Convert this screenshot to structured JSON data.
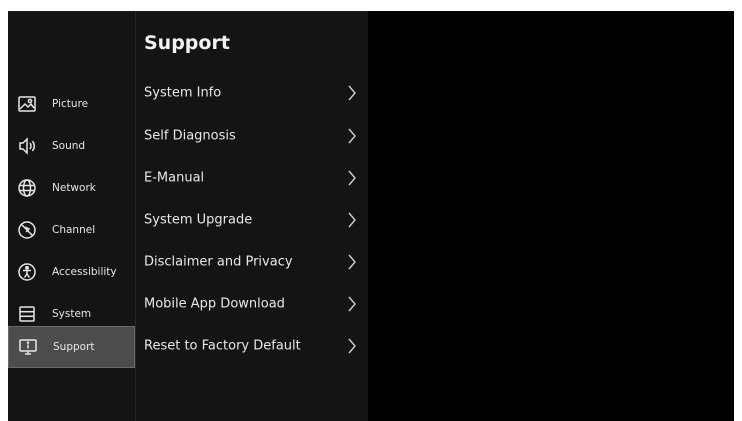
{
  "sidebar": {
    "items": [
      {
        "id": "picture",
        "label": "Picture",
        "icon": "picture-icon",
        "selected": false
      },
      {
        "id": "sound",
        "label": "Sound",
        "icon": "speaker-icon",
        "selected": false
      },
      {
        "id": "network",
        "label": "Network",
        "icon": "globe-icon",
        "selected": false
      },
      {
        "id": "channel",
        "label": "Channel",
        "icon": "channel-icon",
        "selected": false
      },
      {
        "id": "accessibility",
        "label": "Accessibility",
        "icon": "accessibility-icon",
        "selected": false
      },
      {
        "id": "system",
        "label": "System",
        "icon": "system-icon",
        "selected": false
      },
      {
        "id": "support",
        "label": "Support",
        "icon": "support-icon",
        "selected": true
      }
    ]
  },
  "panel": {
    "title": "Support",
    "items": [
      {
        "label": "System Info",
        "icon": "chevron-right-icon"
      },
      {
        "label": "Self Diagnosis",
        "icon": "chevron-right-icon"
      },
      {
        "label": "E-Manual",
        "icon": "chevron-right-icon"
      },
      {
        "label": "System Upgrade",
        "icon": "chevron-right-icon"
      },
      {
        "label": "Disclaimer and Privacy",
        "icon": "chevron-right-icon"
      },
      {
        "label": "Mobile App Download",
        "icon": "chevron-right-icon"
      },
      {
        "label": "Reset to Factory Default",
        "icon": "chevron-right-icon"
      }
    ]
  },
  "colors": {
    "screen_bg": "#000000",
    "panel_bg": "#141414",
    "selected_bg": "#4c4c4c",
    "text": "#e8e8e8"
  }
}
